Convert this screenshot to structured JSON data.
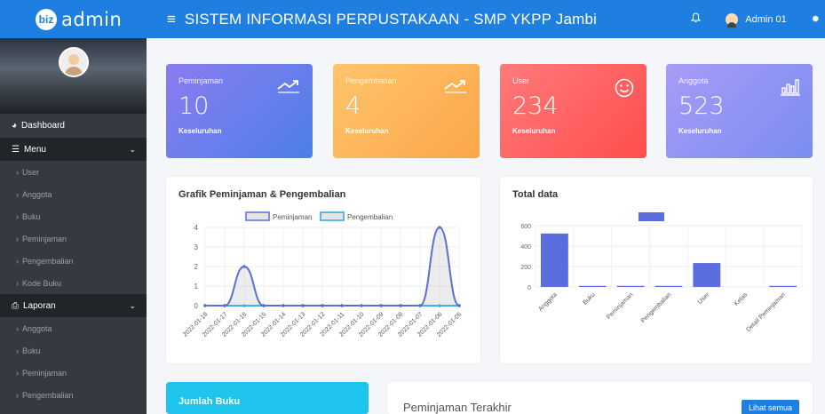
{
  "brand": {
    "logo": "biz",
    "name": "admin"
  },
  "header": {
    "menu_icon": "≡",
    "title": "SISTEM INFORMASI PERPUSTAKAAN - SMP YKPP Jambi",
    "user": "Admin 01"
  },
  "sidebar": {
    "dashboard": "Dashboard",
    "menu": {
      "label": "Menu",
      "items": [
        "User",
        "Anggota",
        "Buku",
        "Peminjaman",
        "Pengembalian",
        "Kode Buku"
      ]
    },
    "laporan": {
      "label": "Laporan",
      "items": [
        "Anggota",
        "Buku",
        "Peminjaman",
        "Pengembalian"
      ]
    }
  },
  "stats": [
    {
      "label": "Peminjaman",
      "value": "10",
      "sub": "Keseluruhan",
      "icon": "trend-up-icon"
    },
    {
      "label": "Pengembalian",
      "value": "4",
      "sub": "Keseluruhan",
      "icon": "trend-up-icon"
    },
    {
      "label": "User",
      "value": "234",
      "sub": "Keseluruhan",
      "icon": "smile-icon"
    },
    {
      "label": "Anggota",
      "value": "523",
      "sub": "Keseluruhan",
      "icon": "bar-chart-icon"
    }
  ],
  "panels": {
    "grafik_title": "Grafik Peminjaman & Pengembalian",
    "total_title": "Total data",
    "jumlah_buku": "Jumlah Buku",
    "peminjaman_terakhir": "Peminjaman Terakhir",
    "lihat_semua": "Lihat semua"
  },
  "chart_data": [
    {
      "type": "line",
      "title": "Grafik Peminjaman & Pengembalian",
      "categories": [
        "2022-01-18",
        "2022-01-17",
        "2022-01-16",
        "2022-01-15",
        "2022-01-14",
        "2022-01-13",
        "2022-01-12",
        "2022-01-11",
        "2022-01-10",
        "2022-01-09",
        "2022-01-08",
        "2022-01-07",
        "2022-01-06",
        "2022-01-05"
      ],
      "series": [
        {
          "name": "Peminjaman",
          "values": [
            0,
            0,
            2,
            0,
            0,
            0,
            0,
            0,
            0,
            0,
            0,
            0,
            4,
            0
          ],
          "color": "#5b6fd6"
        },
        {
          "name": "Pengembalian",
          "values": [
            0,
            0,
            0,
            0,
            0,
            0,
            0,
            0,
            0,
            0,
            0,
            0,
            0,
            0
          ],
          "color": "#2aa6d8"
        }
      ],
      "ylim": [
        0,
        4
      ],
      "yticks": [
        0,
        1,
        2,
        3,
        4
      ],
      "legend": "top"
    },
    {
      "type": "bar",
      "title": "Total data",
      "categories": [
        "Anggota",
        "Buku",
        "Peminjaman",
        "Pengembalian",
        "User",
        "Kelas",
        "Detail Peminjaman"
      ],
      "values": [
        523,
        5,
        10,
        4,
        234,
        0,
        5
      ],
      "color": "#5b6ee0",
      "ylim": [
        0,
        600
      ],
      "yticks": [
        0,
        200,
        400,
        600
      ],
      "legend": "top"
    }
  ]
}
